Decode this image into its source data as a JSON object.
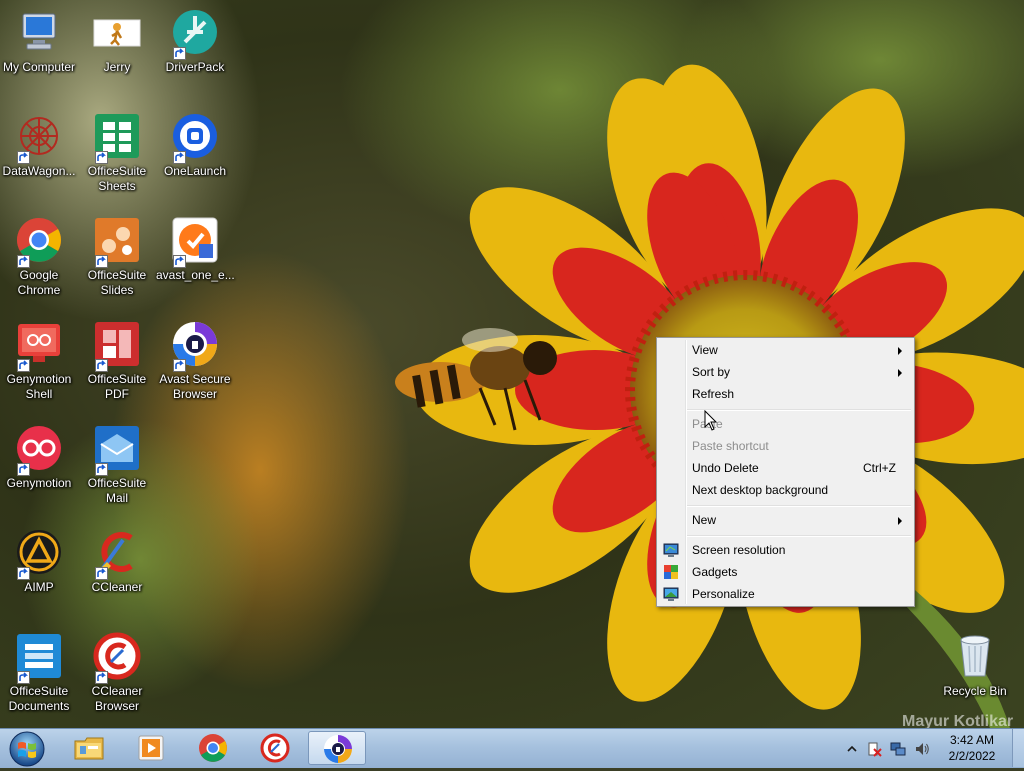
{
  "desktop": {
    "icons": [
      {
        "label": "My Computer",
        "icon": "computer-icon"
      },
      {
        "label": "Jerry",
        "icon": "jerry-icon"
      },
      {
        "label": "DriverPack",
        "icon": "driverpack-icon"
      },
      {
        "label": "DataWagon...",
        "icon": "datawagon-icon"
      },
      {
        "label": "OfficeSuite Sheets",
        "icon": "officesuite-sheets-icon"
      },
      {
        "label": "OneLaunch",
        "icon": "onelaunch-icon"
      },
      {
        "label": "Google Chrome",
        "icon": "chrome-icon"
      },
      {
        "label": "OfficeSuite Slides",
        "icon": "officesuite-slides-icon"
      },
      {
        "label": "avast_one_e...",
        "icon": "avast-one-icon"
      },
      {
        "label": "Genymotion Shell",
        "icon": "genymotion-shell-icon"
      },
      {
        "label": "OfficeSuite PDF",
        "icon": "officesuite-pdf-icon"
      },
      {
        "label": "Avast Secure Browser",
        "icon": "avast-secure-browser-icon"
      },
      {
        "label": "Genymotion",
        "icon": "genymotion-icon"
      },
      {
        "label": "OfficeSuite Mail",
        "icon": "officesuite-mail-icon"
      },
      {
        "label": "AIMP",
        "icon": "aimp-icon"
      },
      {
        "label": "CCleaner",
        "icon": "ccleaner-icon"
      },
      {
        "label": "OfficeSuite Documents",
        "icon": "officesuite-documents-icon"
      },
      {
        "label": "CCleaner Browser",
        "icon": "ccleaner-browser-icon"
      },
      {
        "label": "Recycle Bin",
        "icon": "recycle-bin-icon"
      }
    ],
    "watermark": "Mayur Kotlikar"
  },
  "context_menu": {
    "view": "View",
    "sort_by": "Sort by",
    "refresh": "Refresh",
    "paste": "Paste",
    "paste_shortcut": "Paste shortcut",
    "undo_delete": "Undo Delete",
    "undo_shortcut": "Ctrl+Z",
    "next_background": "Next desktop background",
    "new": "New",
    "screen_resolution": "Screen resolution",
    "gadgets": "Gadgets",
    "personalize": "Personalize"
  },
  "taskbar": {
    "pinned": [
      "file-explorer-icon",
      "media-player-icon",
      "chrome-icon",
      "ccleaner-browser-icon",
      "avast-secure-browser-icon"
    ],
    "clock_time": "3:42 AM",
    "clock_date": "2/2/2022"
  },
  "colors": {
    "menu_bg": "#f0f0f0",
    "taskbar": "#a6c1de",
    "disabled_text": "#8d8d8d"
  }
}
